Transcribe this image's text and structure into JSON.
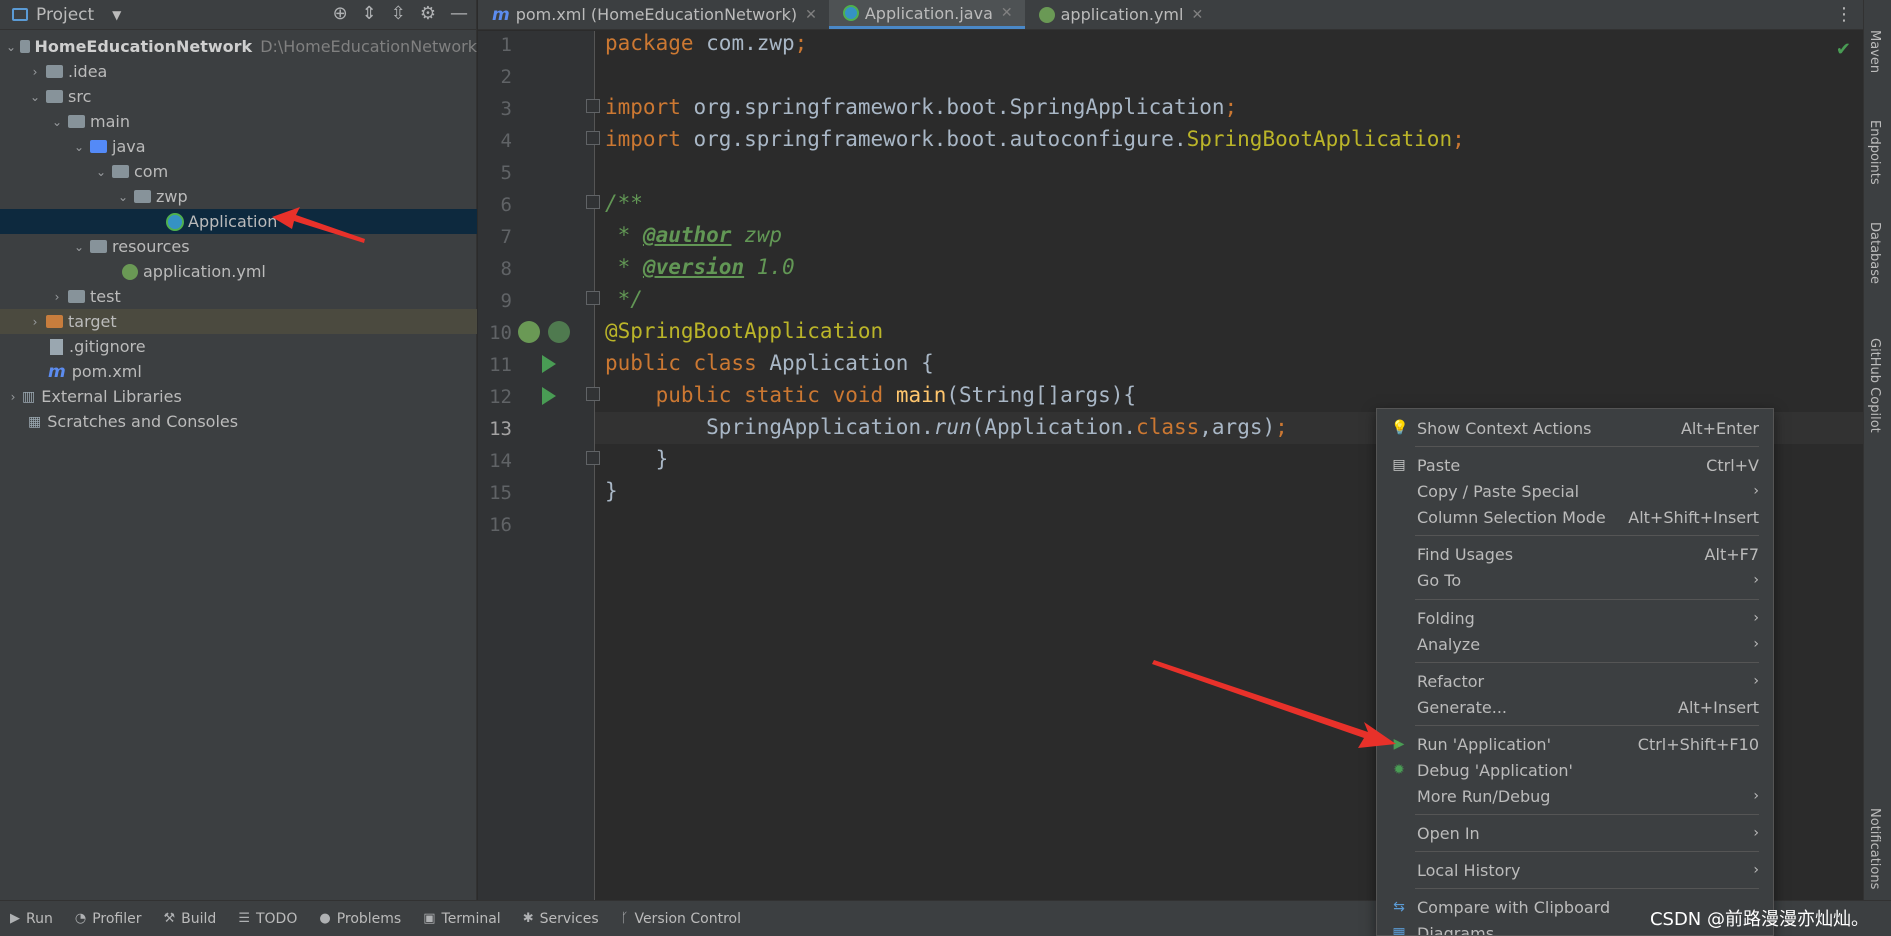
{
  "project_panel": {
    "title": "Project",
    "tree": [
      {
        "label": "HomeEducationNetwork",
        "path": "D:\\HomeEducationNetwork"
      },
      {
        "label": ".idea"
      },
      {
        "label": "src"
      },
      {
        "label": "main"
      },
      {
        "label": "java"
      },
      {
        "label": "com"
      },
      {
        "label": "zwp"
      },
      {
        "label": "Application"
      },
      {
        "label": "resources"
      },
      {
        "label": "application.yml"
      },
      {
        "label": "test"
      },
      {
        "label": "target"
      },
      {
        "label": ".gitignore"
      },
      {
        "label": "pom.xml"
      },
      {
        "label": "External Libraries"
      },
      {
        "label": "Scratches and Consoles"
      }
    ]
  },
  "tabs": [
    {
      "label": "pom.xml (HomeEducationNetwork)"
    },
    {
      "label": "Application.java"
    },
    {
      "label": "application.yml"
    }
  ],
  "editor": {
    "line_numbers": [
      "1",
      "2",
      "3",
      "4",
      "5",
      "6",
      "7",
      "8",
      "9",
      "10",
      "11",
      "12",
      "13",
      "14",
      "15",
      "16"
    ],
    "lines": {
      "l1_kw": "package",
      "l1_rest": " com.zwp",
      "l1_semi": ";",
      "l3_kw": "import",
      "l3_rest": " org.springframework.boot.SpringApplication",
      "l3_semi": ";",
      "l4_kw": "import",
      "l4_rest": " org.springframework.boot.autoconfigure.",
      "l4_ann": "SpringBootApplication",
      "l4_semi": ";",
      "l6": "/**",
      "l7_pre": " * ",
      "l7_tag": "@author",
      "l7_val": " zwp",
      "l8_pre": " * ",
      "l8_tag": "@version",
      "l8_val": " 1.0",
      "l9": " */",
      "l10": "@SpringBootApplication",
      "l11_kw": "public class",
      "l11_rest": " Application {",
      "l12_indent": "    ",
      "l12_kw": "public static void",
      "l12_sp": " ",
      "l12_fn": "main",
      "l12_rest": "(String[]args){",
      "l13_indent": "        ",
      "l13_a": "SpringApplication.",
      "l13_run": "run",
      "l13_b": "(Application.",
      "l13_kw": "class",
      "l13_c": ",args)",
      "l13_semi": ";",
      "l14": "    }",
      "l15": "}"
    }
  },
  "right_sidebar": [
    "Maven",
    "Endpoints",
    "Database",
    "GitHub Copilot",
    "Notifications"
  ],
  "bottom_bar": [
    "Run",
    "Profiler",
    "Build",
    "TODO",
    "Problems",
    "Terminal",
    "Services",
    "Version Control"
  ],
  "context_menu": {
    "items": [
      {
        "label": "Show Context Actions",
        "shortcut": "Alt+Enter"
      },
      {
        "label": "Paste",
        "shortcut": "Ctrl+V"
      },
      {
        "label": "Copy / Paste Special",
        "shortcut": ""
      },
      {
        "label": "Column Selection Mode",
        "shortcut": "Alt+Shift+Insert"
      },
      {
        "label": "Find Usages",
        "shortcut": "Alt+F7"
      },
      {
        "label": "Go To",
        "shortcut": ""
      },
      {
        "label": "Folding",
        "shortcut": ""
      },
      {
        "label": "Analyze",
        "shortcut": ""
      },
      {
        "label": "Refactor",
        "shortcut": ""
      },
      {
        "label": "Generate...",
        "shortcut": "Alt+Insert"
      },
      {
        "label": "Run 'Application'",
        "shortcut": "Ctrl+Shift+F10"
      },
      {
        "label": "Debug 'Application'",
        "shortcut": ""
      },
      {
        "label": "More Run/Debug",
        "shortcut": ""
      },
      {
        "label": "Open In",
        "shortcut": ""
      },
      {
        "label": "Local History",
        "shortcut": ""
      },
      {
        "label": "Compare with Clipboard",
        "shortcut": ""
      },
      {
        "label": "Diagrams",
        "shortcut": ""
      }
    ]
  },
  "watermark": "CSDN @前路漫漫亦灿灿。",
  "colors": {
    "keyword": "#cc7832",
    "annotation": "#bbb529",
    "comment": "#629755",
    "arrow": "#e8312a",
    "run_green": "#499c54"
  }
}
